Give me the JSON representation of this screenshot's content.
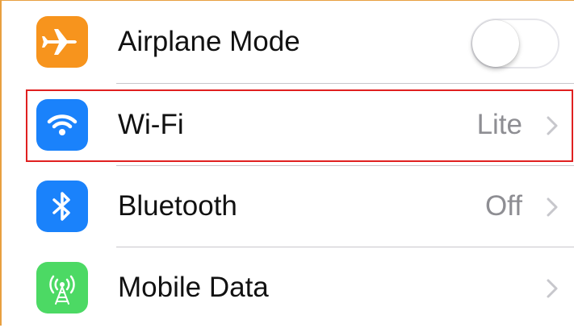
{
  "settings": {
    "rows": [
      {
        "label": "Airplane Mode",
        "icon": "airplane-icon",
        "icon_color": "#f7941d",
        "toggle_on": false
      },
      {
        "label": "Wi-Fi",
        "value": "Lite",
        "icon": "wifi-icon",
        "icon_color": "#1a82fb",
        "highlighted": true
      },
      {
        "label": "Bluetooth",
        "value": "Off",
        "icon": "bluetooth-icon",
        "icon_color": "#1a82fb"
      },
      {
        "label": "Mobile Data",
        "value": "",
        "icon": "cellular-antenna-icon",
        "icon_color": "#4cd964"
      }
    ]
  },
  "colors": {
    "highlight_border": "#e02020",
    "frame_border": "#e8a040",
    "value_gray": "#8e8e93"
  }
}
